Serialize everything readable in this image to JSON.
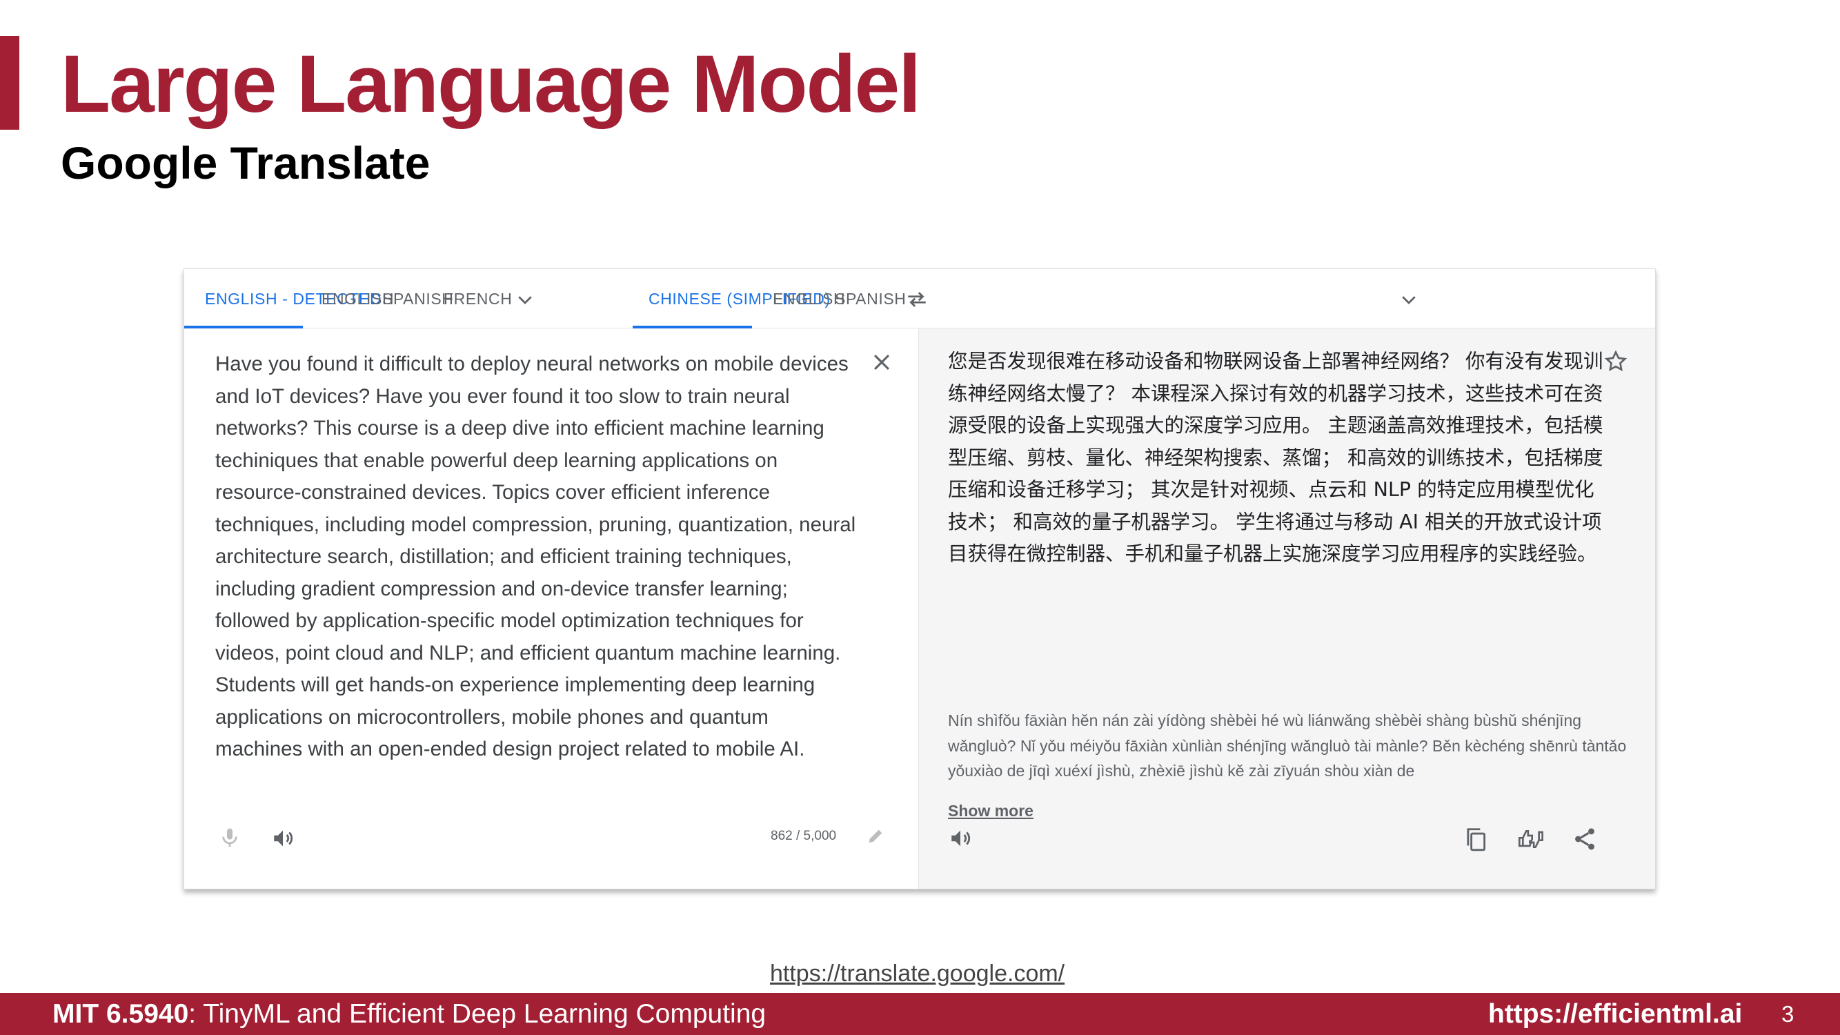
{
  "slide": {
    "title": "Large Language Model",
    "subtitle": "Google Translate",
    "url": "https://translate.google.com/",
    "page_number": "3",
    "colors": {
      "accent": "#a31f34",
      "link": "#1a73e8"
    }
  },
  "footer": {
    "course_code": "MIT 6.5940",
    "course_name": ": TinyML and Efficient Deep Learning Computing",
    "site": "https://efficientml.ai"
  },
  "translate": {
    "source_tabs": [
      "ENGLISH - DETECTED",
      "ENGLISH",
      "SPANISH",
      "FRENCH"
    ],
    "target_tabs": [
      "CHINESE (SIMPLIFIED)",
      "ENGLISH",
      "SPANISH"
    ],
    "source_text": "Have you found it difficult to deploy neural networks on mobile devices and IoT devices? Have you ever found it too slow to train neural networks? This course is a deep dive into efficient machine learning techiniques that enable powerful deep learning applications on resource-constrained devices. Topics cover efficient inference techniques, including model compression, pruning, quantization, neural architecture search, distillation; and efficient training techniques, including gradient compression and on-device transfer learning; followed by application-specific model optimization techniques for videos, point cloud and NLP; and efficient quantum machine learning. Students will get hands-on experience implementing deep learning applications on microcontrollers, mobile phones and quantum machines with an open-ended design project related to mobile AI.",
    "char_count": "862 / 5,000",
    "translated_text": "您是否发现很难在移动设备和物联网设备上部署神经网络？ 你有没有发现训练神经网络太慢了？ 本课程深入探讨有效的机器学习技术，这些技术可在资源受限的设备上实现强大的深度学习应用。 主题涵盖高效推理技术，包括模型压缩、剪枝、量化、神经架构搜索、蒸馏； 和高效的训练技术，包括梯度压缩和设备迁移学习； 其次是针对视频、点云和 NLP 的特定应用模型优化技术； 和高效的量子机器学习。 学生将通过与移动 AI 相关的开放式设计项目获得在微控制器、手机和量子机器上实施深度学习应用程序的实践经验。",
    "pinyin": "Nín shìfǒu fāxiàn hěn nán zài yídòng shèbèi hé wù liánwǎng shèbèi shàng bùshǔ shénjīng wǎngluò? Nǐ yǒu méiyǒu fāxiàn xùnliàn shénjīng wǎngluò tài mànle? Běn kèchéng shēnrù tàntǎo yǒuxiào de jīqì xuéxí jìshù, zhèxiē jìshù kě zài zīyuán shòu xiàn de",
    "show_more": "Show more",
    "icons": [
      "swap-languages-icon",
      "chevron-down-icon",
      "close-icon",
      "star-icon",
      "microphone-icon",
      "speaker-icon",
      "pencil-icon",
      "copy-icon",
      "rate-translation-icon",
      "share-icon"
    ]
  }
}
